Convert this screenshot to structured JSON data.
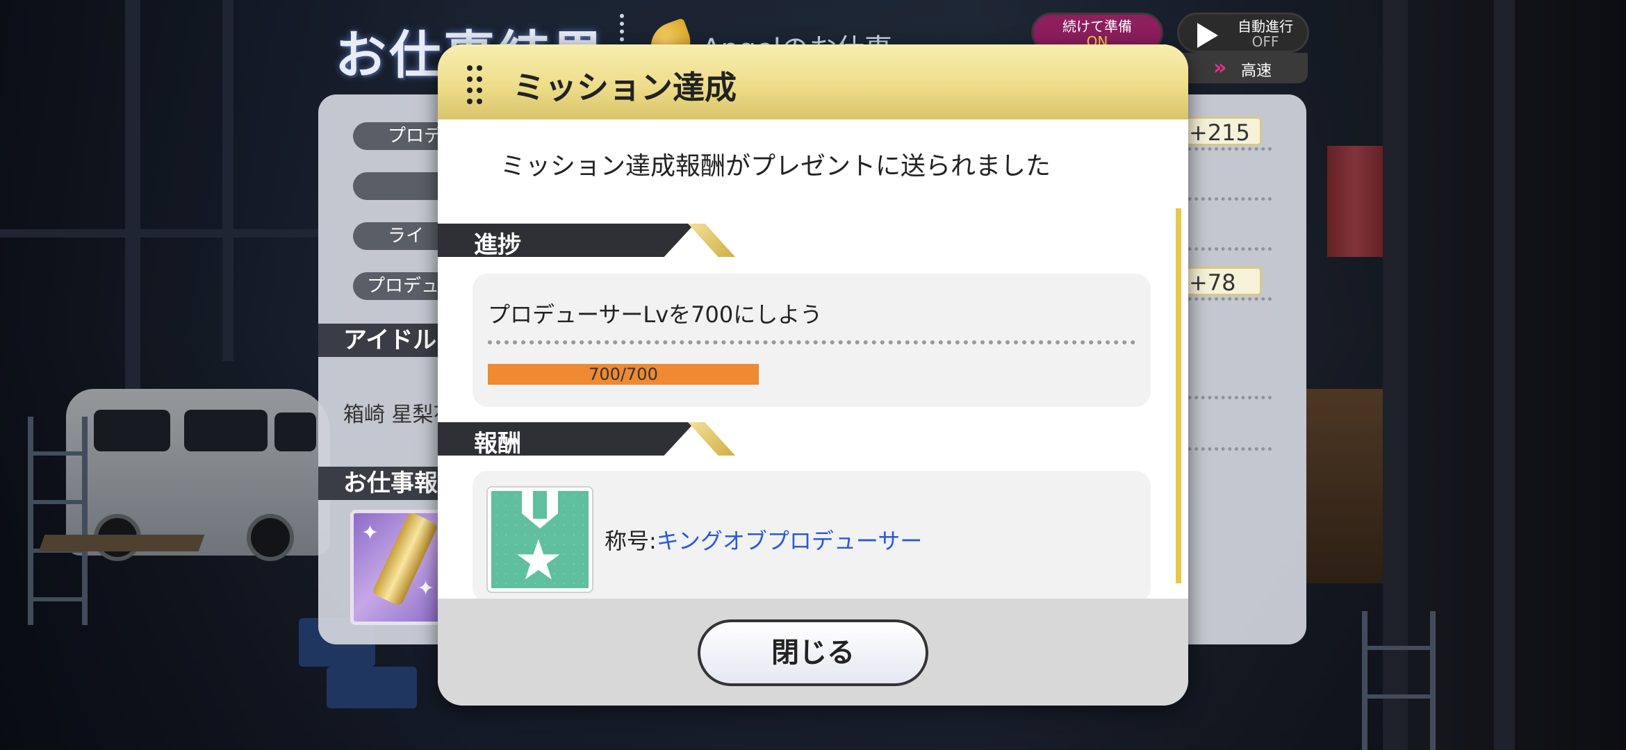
{
  "background": {
    "screen_title": "お仕事結果",
    "job_title": "Angelのお仕事",
    "prep_button": {
      "label": "続けて準備",
      "state": "ON"
    },
    "auto_button": {
      "label": "自動進行",
      "state": "OFF"
    },
    "speed_label": "高速",
    "rows": [
      {
        "label": "プロデ",
        "value": "+215"
      },
      {
        "label": "",
        "value": ""
      },
      {
        "label": "ライ",
        "value": ""
      },
      {
        "label": "プロデュ",
        "value": "+78"
      }
    ],
    "section_idol": "アイドル",
    "idol_name": "箱崎 星梨花",
    "section_reward": "お仕事報"
  },
  "modal": {
    "title": "ミッション達成",
    "message": "ミッション達成報酬がプレゼントに送られました",
    "progress_section": "進捗",
    "mission_text": "プロデューサーLvを700にしよう",
    "progress": {
      "text": "700/700",
      "current": 700,
      "max": 700,
      "fraction": 1.0
    },
    "reward_section": "報酬",
    "reward_prefix": "称号:",
    "reward_name": "キングオブプロデューサー",
    "close_label": "閉じる"
  },
  "colors": {
    "header_gold": "#eedd8a",
    "progress_orange": "#ee8a31",
    "reward_link": "#2a5ad8",
    "prep_button": "#8e1e5e"
  },
  "icons": {
    "grip": "grip-dots-icon",
    "reward": "medal-star-icon",
    "speed": "double-chevron-icon",
    "auto": "play-icon"
  }
}
